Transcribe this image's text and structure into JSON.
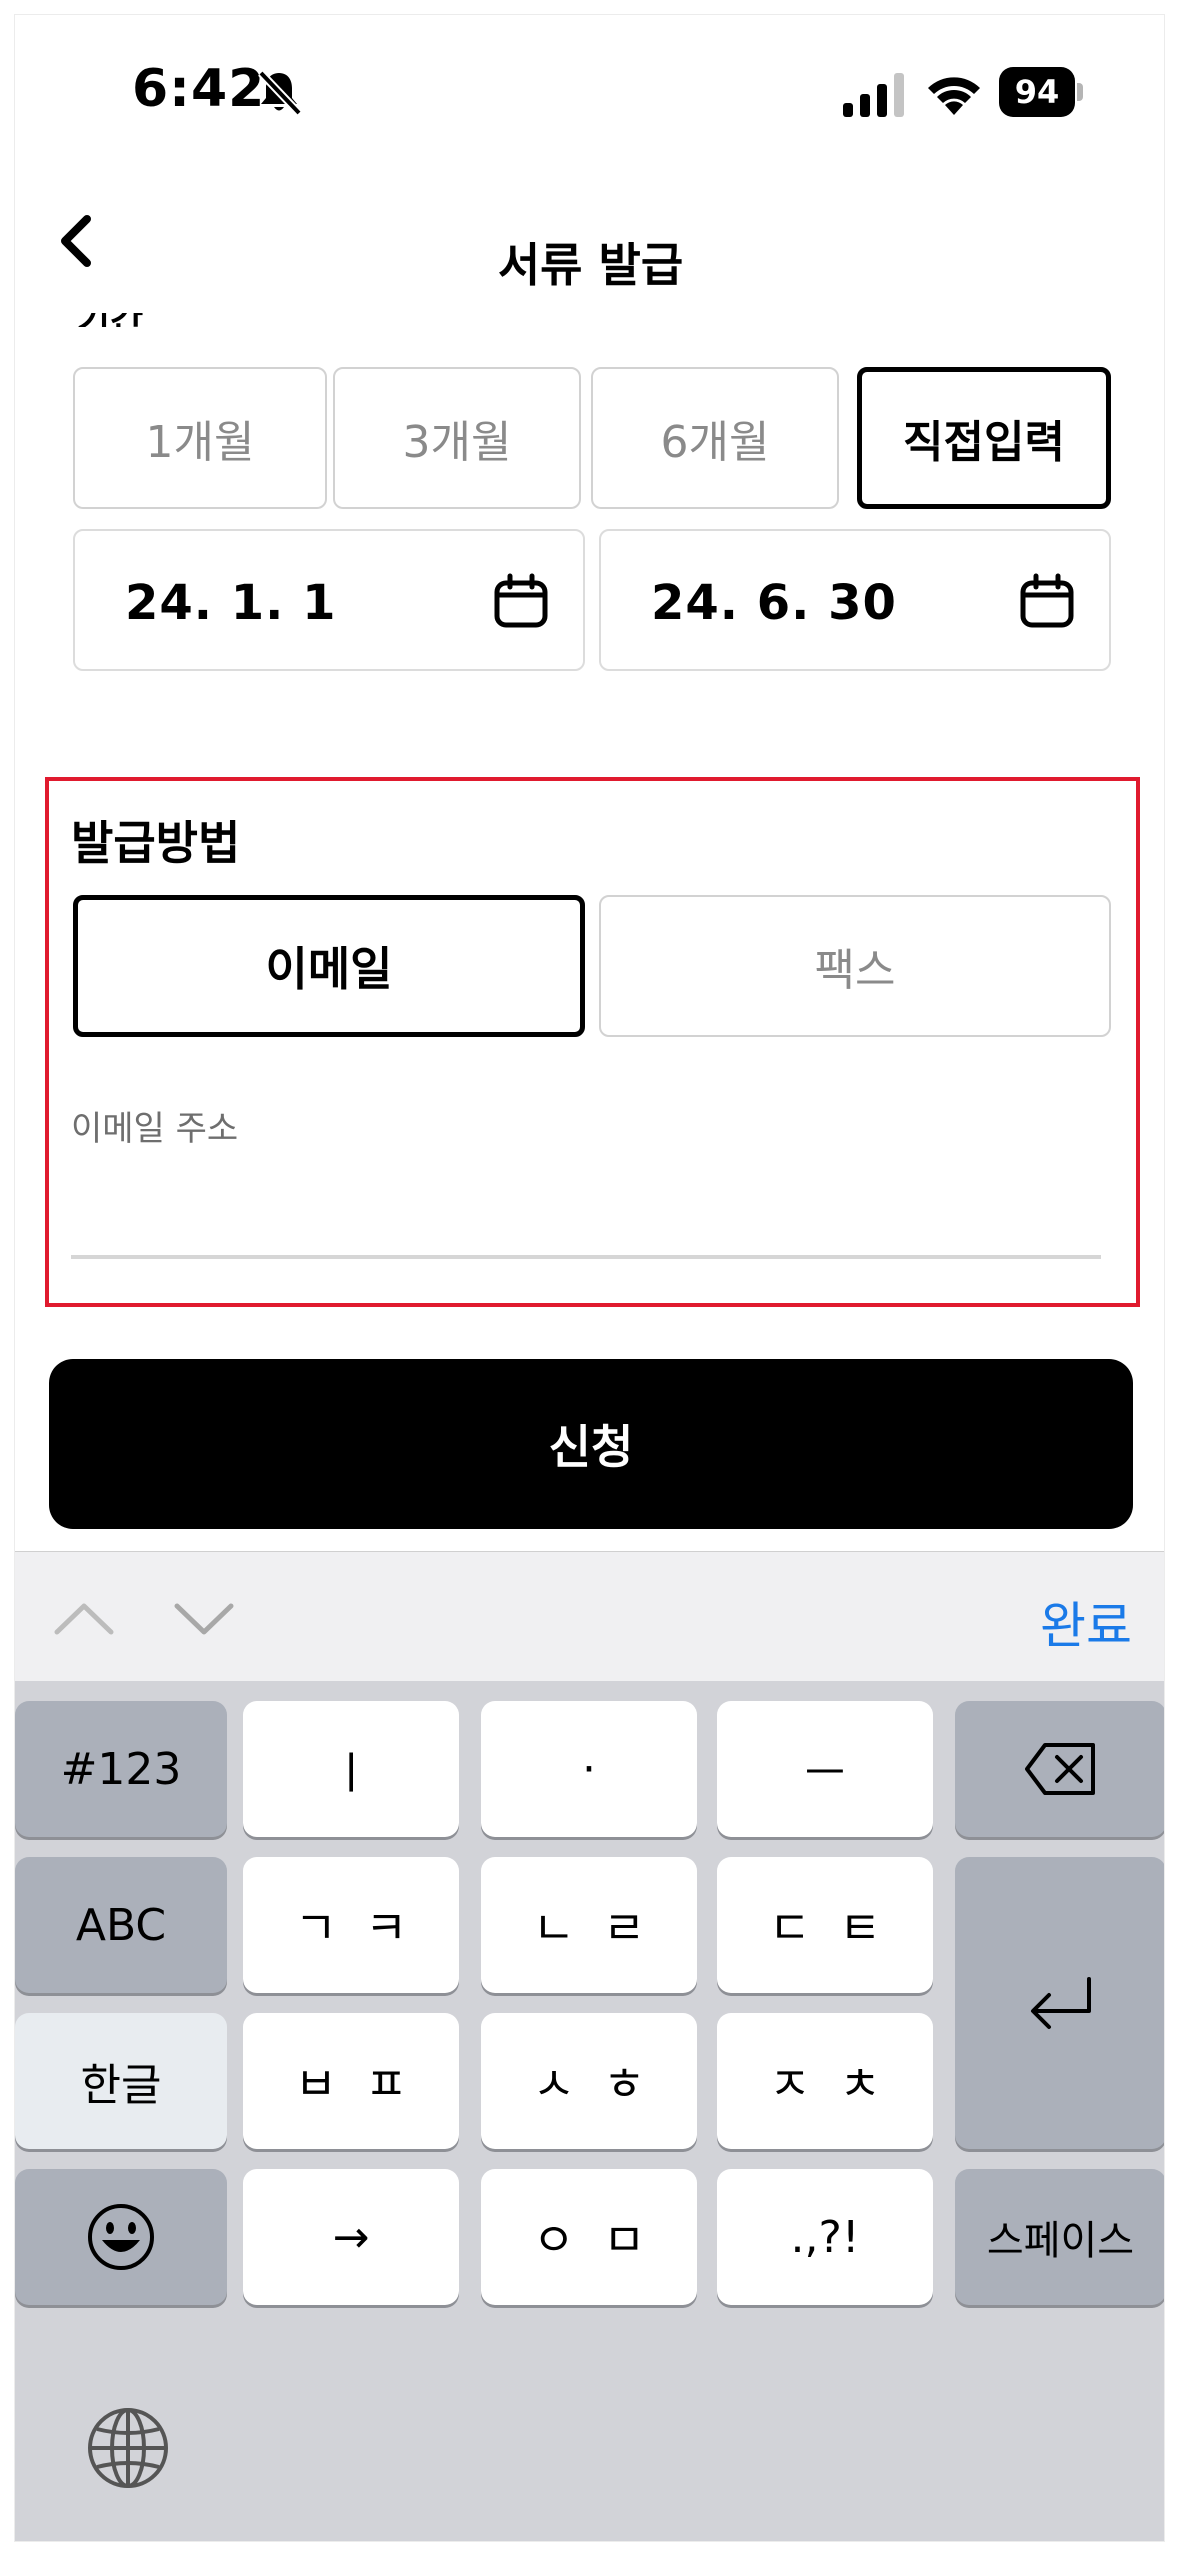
{
  "status_bar": {
    "time": "6:42",
    "battery": "94"
  },
  "nav": {
    "title": "서류 발급",
    "partial_label": "기간"
  },
  "period": {
    "options": [
      "1개월",
      "3개월",
      "6개월",
      "직접입력"
    ],
    "selected": "직접입력",
    "start_date": "24. 1. 1",
    "end_date": "24. 6. 30"
  },
  "issue_method": {
    "title": "발급방법",
    "options": [
      "이메일",
      "팩스"
    ],
    "selected": "이메일",
    "email_label": "이메일 주소",
    "email_value": ""
  },
  "submit_label": "신청",
  "keyboard": {
    "done_label": "완료",
    "rows": [
      [
        "#123",
        "ㅣ",
        "·",
        "ㅡ"
      ],
      [
        "ABC",
        "ㄱㅋ",
        "ㄴㄹ",
        "ㄷㅌ"
      ],
      [
        "한글",
        "ㅂㅍ",
        "ㅅㅎ",
        "ㅈㅊ"
      ],
      [
        "→",
        "ㅇㅁ",
        ".,?!",
        "스페이스"
      ]
    ]
  },
  "colors": {
    "highlight": "#e01a2e",
    "accent": "#1a7ae8"
  },
  "icons": [
    "back-chevron-icon",
    "silent-bell-icon",
    "signal-icon",
    "wifi-icon",
    "calendar-icon",
    "backspace-icon",
    "return-icon",
    "emoji-icon",
    "globe-icon"
  ]
}
